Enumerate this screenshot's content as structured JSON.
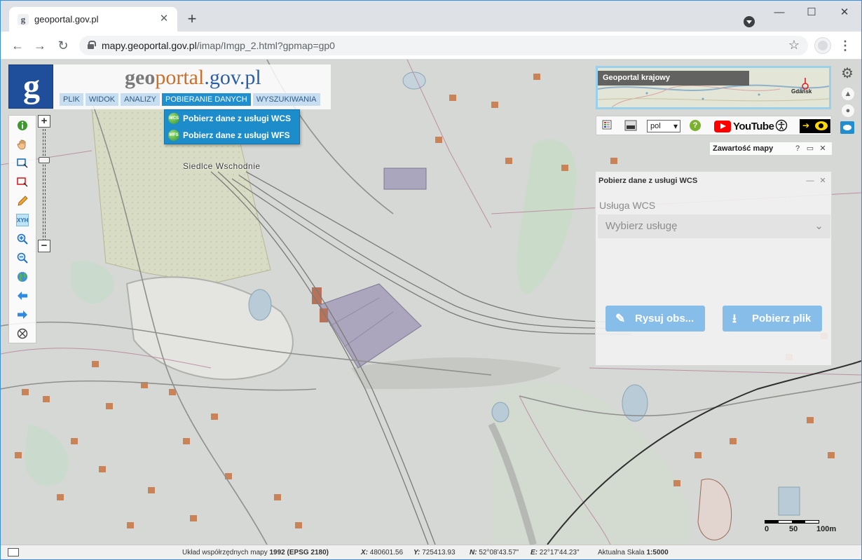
{
  "browser": {
    "tab_title": "geoportal.gov.pl",
    "favicon_letter": "g",
    "tab_close": "✕",
    "new_tab": "+",
    "url_host": "mapy.geoportal.gov.pl",
    "url_path": "/imap/Imgp_2.html?gpmap=gp0",
    "window": {
      "minimize": "—",
      "maximize": "☐",
      "close": "✕"
    },
    "nav": {
      "back": "←",
      "forward": "→",
      "reload": "↻"
    },
    "star": "☆",
    "menu": "⋮"
  },
  "portal": {
    "logo_letter": "g",
    "brand_g": "g",
    "brand_eo": "eo",
    "brand_portal": "portal",
    "brand_tail": ".gov.pl",
    "menu": [
      {
        "label": "PLIK"
      },
      {
        "label": "WIDOK"
      },
      {
        "label": "ANALIZY"
      },
      {
        "label": "POBIERANIE DANYCH"
      },
      {
        "label": "WYSZUKIWANIA"
      }
    ],
    "dropdown": [
      {
        "icon": "WCS",
        "label": "Pobierz dane z usługi WCS"
      },
      {
        "icon": "WFS",
        "label": "Pobierz dane z usługi WFS"
      }
    ]
  },
  "tools": {
    "zoom_in": "+",
    "zoom_out": "−",
    "xyh_label": "XYH"
  },
  "map": {
    "station_label": "Siedlce Wschodnie",
    "overview_title": "Geoportal krajowy",
    "overview_city": "Gdańsk"
  },
  "toolrow": {
    "lang": "pol",
    "help": "?",
    "youtube": "YouTube",
    "contrast_arrow": "➔"
  },
  "contents": {
    "title": "Zawartość mapy",
    "help": "?",
    "restore": "▭",
    "close": "✕"
  },
  "wcs_panel": {
    "title": "Pobierz dane z usługi WCS",
    "minimize": "—",
    "close": "✕",
    "service_label": "Usługa WCS",
    "select_placeholder": "Wybierz usługę",
    "draw_button": "Rysuj obs...",
    "download_button": "Pobierz plik"
  },
  "scale": {
    "t0": "0",
    "t50": "50",
    "t100": "100m"
  },
  "status": {
    "crs_label": "Układ współrzędnych mapy",
    "crs_value": "1992 (EPSG 2180)",
    "x_label": "X:",
    "x_value": "480601.56",
    "y_label": "Y:",
    "y_value": "725413.93",
    "n_label": "N:",
    "n_value": "52°08'43.57\"",
    "e_label": "E:",
    "e_value": "22°17'44.23\"",
    "scale_label": "Aktualna Skala",
    "scale_value": "1:5000"
  },
  "colors": {
    "accent": "#1f8fd0",
    "logo_bg": "#1f4e9a",
    "menu_bg": "#c7def0",
    "button_bg": "#86bde9",
    "youtube_red": "#ff0000"
  }
}
